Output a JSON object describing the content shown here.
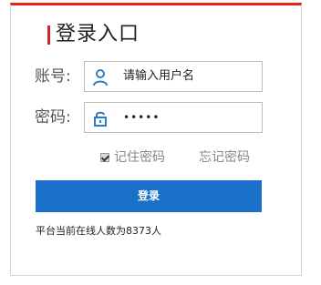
{
  "header": {
    "title": "登录入口"
  },
  "form": {
    "username": {
      "label": "账号:",
      "placeholder": "请输入用户名",
      "icon": "user-icon"
    },
    "password": {
      "label": "密码:",
      "value": "•••••",
      "icon": "lock-icon"
    },
    "remember_label": "记住密码",
    "remember_checked": true,
    "forgot_label": "忘记密码",
    "submit_label": "登录"
  },
  "footer": {
    "online_prefix": "平台当前在线人数为",
    "online_count": "8373",
    "online_suffix": "人"
  },
  "colors": {
    "accent": "#e2231a",
    "button": "#1a6fc8",
    "icon": "#2f7cc6"
  }
}
